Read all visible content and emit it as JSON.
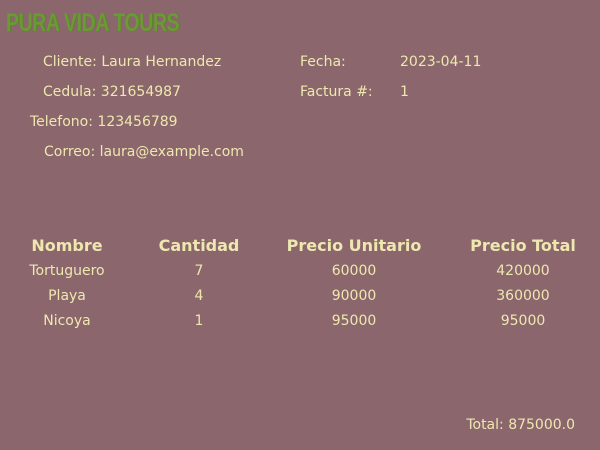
{
  "brand": {
    "name": "PURA VIDA TOURS"
  },
  "invoice": {
    "cliente_label": "Cliente:",
    "cliente_value": "Laura Hernandez",
    "cedula_label": "Cedula:",
    "cedula_value": "321654987",
    "telefono_label": "Telefono:",
    "telefono_value": "123456789",
    "correo_label": "Correo:",
    "correo_value": "laura@example.com",
    "fecha_label": "Fecha:",
    "fecha_value": "2023-04-11",
    "factura_label": "Factura #:",
    "factura_value": "1"
  },
  "table": {
    "headers": [
      "Nombre",
      "Cantidad",
      "Precio Unitario",
      "Precio Total"
    ],
    "rows": [
      [
        "Tortuguero",
        "7",
        "60000",
        "420000"
      ],
      [
        "Playa",
        "4",
        "90000",
        "360000"
      ],
      [
        "Nicoya",
        "1",
        "95000",
        "95000"
      ]
    ]
  },
  "summary": {
    "total_text": "Total: 875000.0"
  }
}
